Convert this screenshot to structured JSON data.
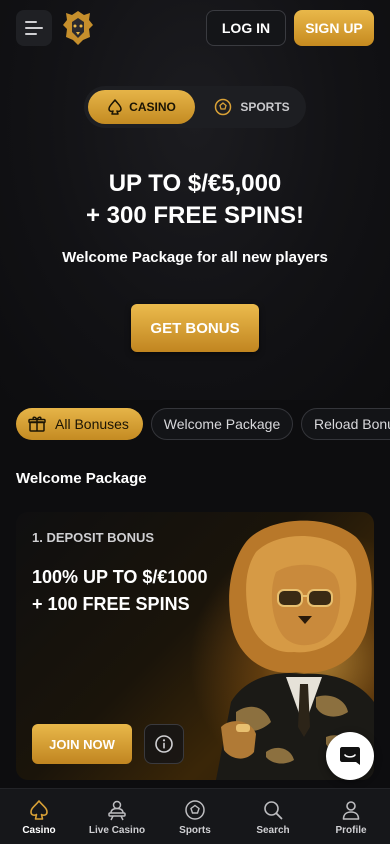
{
  "header": {
    "login_label": "LOG IN",
    "signup_label": "SIGN UP"
  },
  "toggle": {
    "casino_label": "CASINO",
    "sports_label": "SPORTS"
  },
  "hero": {
    "title_line1": "UP TO $/€5,000",
    "title_line2": "+ 300 FREE SPINS!",
    "subtitle": "Welcome Package for all new players",
    "cta_label": "GET BONUS"
  },
  "filters": [
    {
      "label": "All Bonuses",
      "active": true
    },
    {
      "label": "Welcome Package",
      "active": false
    },
    {
      "label": "Reload Bonu",
      "active": false
    }
  ],
  "section_title": "Welcome Package",
  "card": {
    "eyebrow": "1. DEPOSIT BONUS",
    "title_line1": "100% UP TO $/€1000",
    "title_line2": "+ 100 FREE SPINS",
    "join_label": "JOIN NOW"
  },
  "nav": [
    {
      "label": "Casino",
      "icon": "spade-icon",
      "active": true
    },
    {
      "label": "Live Casino",
      "icon": "dealer-icon",
      "active": false
    },
    {
      "label": "Sports",
      "icon": "ball-icon",
      "active": false
    },
    {
      "label": "Search",
      "icon": "search-icon",
      "active": false
    },
    {
      "label": "Profile",
      "icon": "profile-icon",
      "active": false
    }
  ],
  "colors": {
    "accent_gold": "#d9a136",
    "background": "#0d0d0f",
    "surface": "#16171a"
  }
}
